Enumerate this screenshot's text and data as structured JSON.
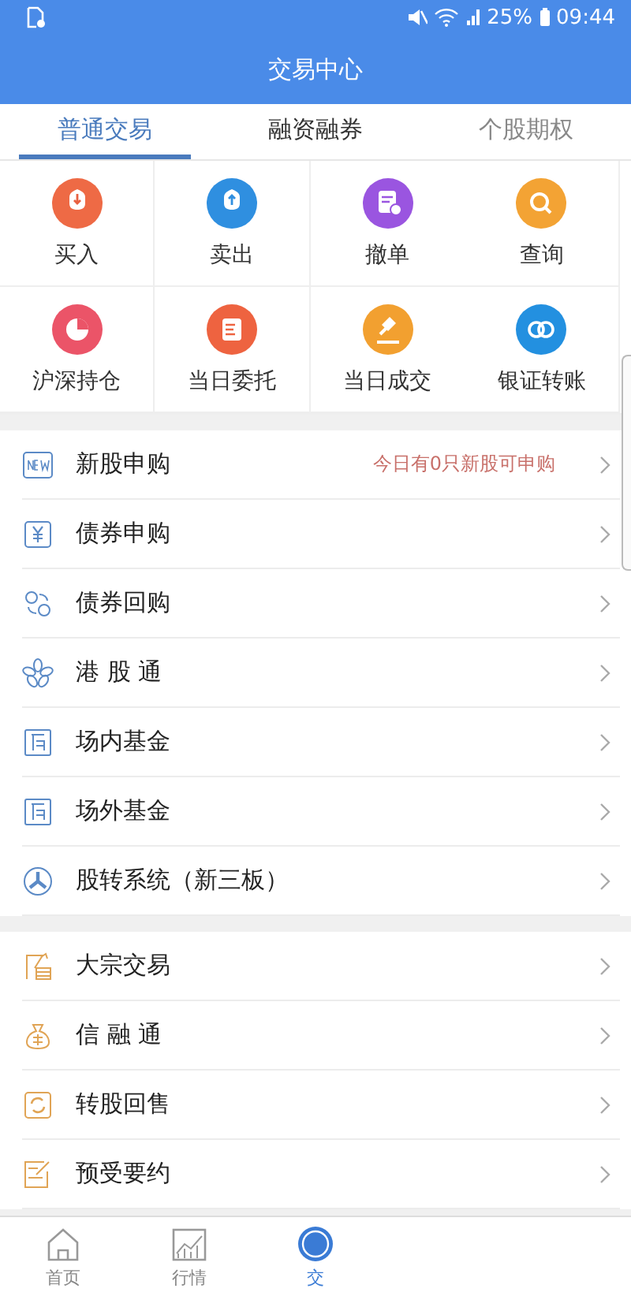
{
  "status_bar": {
    "battery": "25%",
    "time": "09:44"
  },
  "header": {
    "title": "交易中心"
  },
  "tabs": [
    {
      "label": "普通交易",
      "selected": true
    },
    {
      "label": "融资融券",
      "selected": false
    },
    {
      "label": "个股期权",
      "selected": false
    }
  ],
  "quick_actions": [
    {
      "label": "买入",
      "kind": "buy",
      "color": "#ee6a45"
    },
    {
      "label": "卖出",
      "kind": "sell",
      "color": "#2f8fe0"
    },
    {
      "label": "撤单",
      "kind": "cancel",
      "color": "#9a55e0"
    },
    {
      "label": "查询",
      "kind": "query",
      "color": "#f3a334"
    },
    {
      "label": "沪深持仓",
      "kind": "pie",
      "color": "#eb5468"
    },
    {
      "label": "当日委托",
      "kind": "order",
      "color": "#ee6340"
    },
    {
      "label": "当日成交",
      "kind": "deal",
      "color": "#f2a030"
    },
    {
      "label": "银证转账",
      "kind": "transfer",
      "color": "#2390e0"
    }
  ],
  "sections": [
    {
      "items": [
        {
          "label": "新股申购",
          "kind": "new",
          "note": "今日有0只新股可申购"
        },
        {
          "label": "债券申购",
          "kind": "yen"
        },
        {
          "label": "债券回购",
          "kind": "swap"
        },
        {
          "label": "港 股 通",
          "kind": "flower"
        },
        {
          "label": "场内基金",
          "kind": "fund"
        },
        {
          "label": "场外基金",
          "kind": "fund"
        },
        {
          "label": "股转系统（新三板）",
          "kind": "tri"
        }
      ]
    },
    {
      "items": [
        {
          "label": "大宗交易",
          "kind": "coins"
        },
        {
          "label": "信 融 通",
          "kind": "bag"
        },
        {
          "label": "转股回售",
          "kind": "cycle"
        },
        {
          "label": "预受要约",
          "kind": "sign"
        }
      ]
    }
  ],
  "bottom_nav": [
    {
      "label": "首页",
      "kind": "home",
      "selected": false
    },
    {
      "label": "行情",
      "kind": "chart",
      "selected": false
    },
    {
      "label": "交",
      "kind": "trade",
      "selected": true
    }
  ]
}
